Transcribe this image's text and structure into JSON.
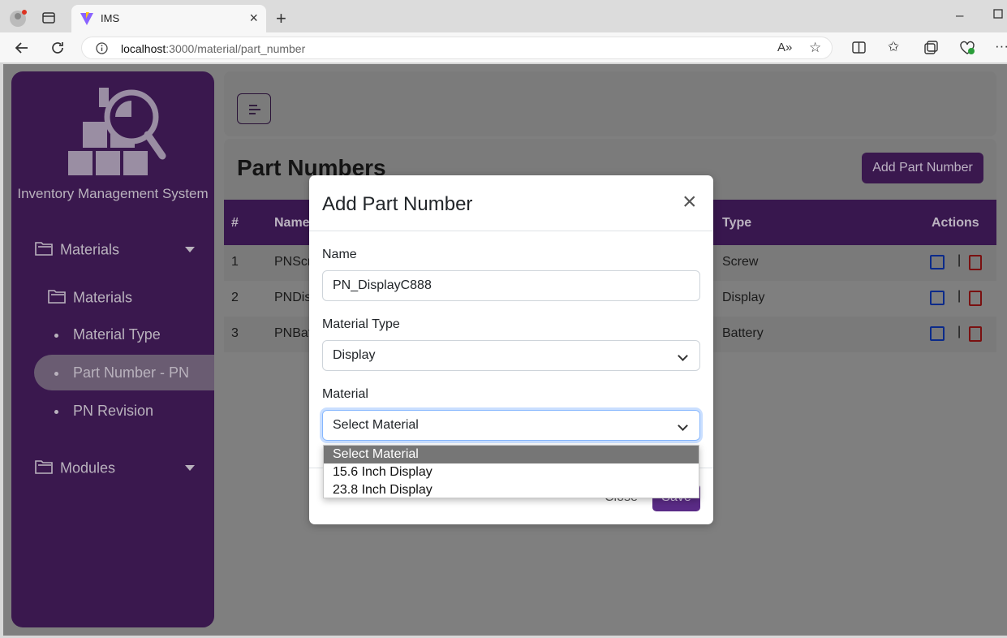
{
  "browser": {
    "tab_title": "IMS",
    "url_host": "localhost",
    "url_path": ":3000/material/part_number"
  },
  "sidebar": {
    "brand": "Inventory Management System",
    "groups": [
      {
        "label": "Materials"
      },
      {
        "label": "Modules"
      }
    ],
    "items": [
      {
        "label": "Materials"
      },
      {
        "label": "Material Type"
      },
      {
        "label": "Part Number - PN"
      },
      {
        "label": "PN Revision"
      }
    ]
  },
  "page": {
    "title": "Part Numbers",
    "add_button": "Add Part Number",
    "table": {
      "headers": [
        "#",
        "Name",
        "Type",
        "Actions"
      ],
      "rows": [
        {
          "num": "1",
          "name": "PNScr",
          "type": "Screw"
        },
        {
          "num": "2",
          "name": "PNDis",
          "type": "Display"
        },
        {
          "num": "3",
          "name": "PNBat",
          "type": "Battery"
        }
      ],
      "separator": "|"
    }
  },
  "modal": {
    "title": "Add Part Number",
    "name_label": "Name",
    "name_value": "PN_DisplayC888",
    "type_label": "Material Type",
    "type_value": "Display",
    "material_label": "Material",
    "material_value": "Select Material",
    "options": [
      "Select Material",
      "15.6 Inch Display",
      "23.8 Inch Display"
    ],
    "close_label": "Close",
    "save_label": "Save"
  },
  "colors": {
    "sidebar": "#3a184e",
    "accent": "#5a2b86",
    "edit_icon": "#0b2a8a",
    "delete_icon": "#7a1010"
  }
}
